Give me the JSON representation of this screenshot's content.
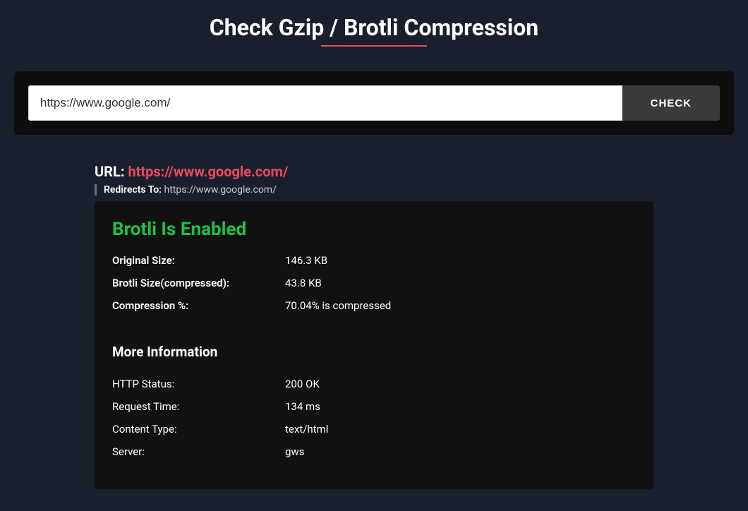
{
  "title": "Check Gzip / Brotli Compression",
  "search": {
    "value": "https://www.google.com/",
    "button_label": "CHECK"
  },
  "result": {
    "url_label": "URL:",
    "url_value": "https://www.google.com/",
    "redirects_label": "Redirects To:",
    "redirects_value": "https://www.google.com/",
    "status_heading": "Brotli Is Enabled",
    "rows": [
      {
        "label": "Original Size:",
        "value": "146.3 KB"
      },
      {
        "label": "Brotli Size(compressed):",
        "value": "43.8 KB"
      },
      {
        "label": "Compression %:",
        "value": "70.04% is compressed"
      }
    ],
    "more_info_heading": "More Information",
    "info_rows": [
      {
        "label": "HTTP Status:",
        "value": "200 OK"
      },
      {
        "label": "Request Time:",
        "value": "134 ms"
      },
      {
        "label": "Content Type:",
        "value": "text/html"
      },
      {
        "label": "Server:",
        "value": "gws"
      }
    ]
  }
}
